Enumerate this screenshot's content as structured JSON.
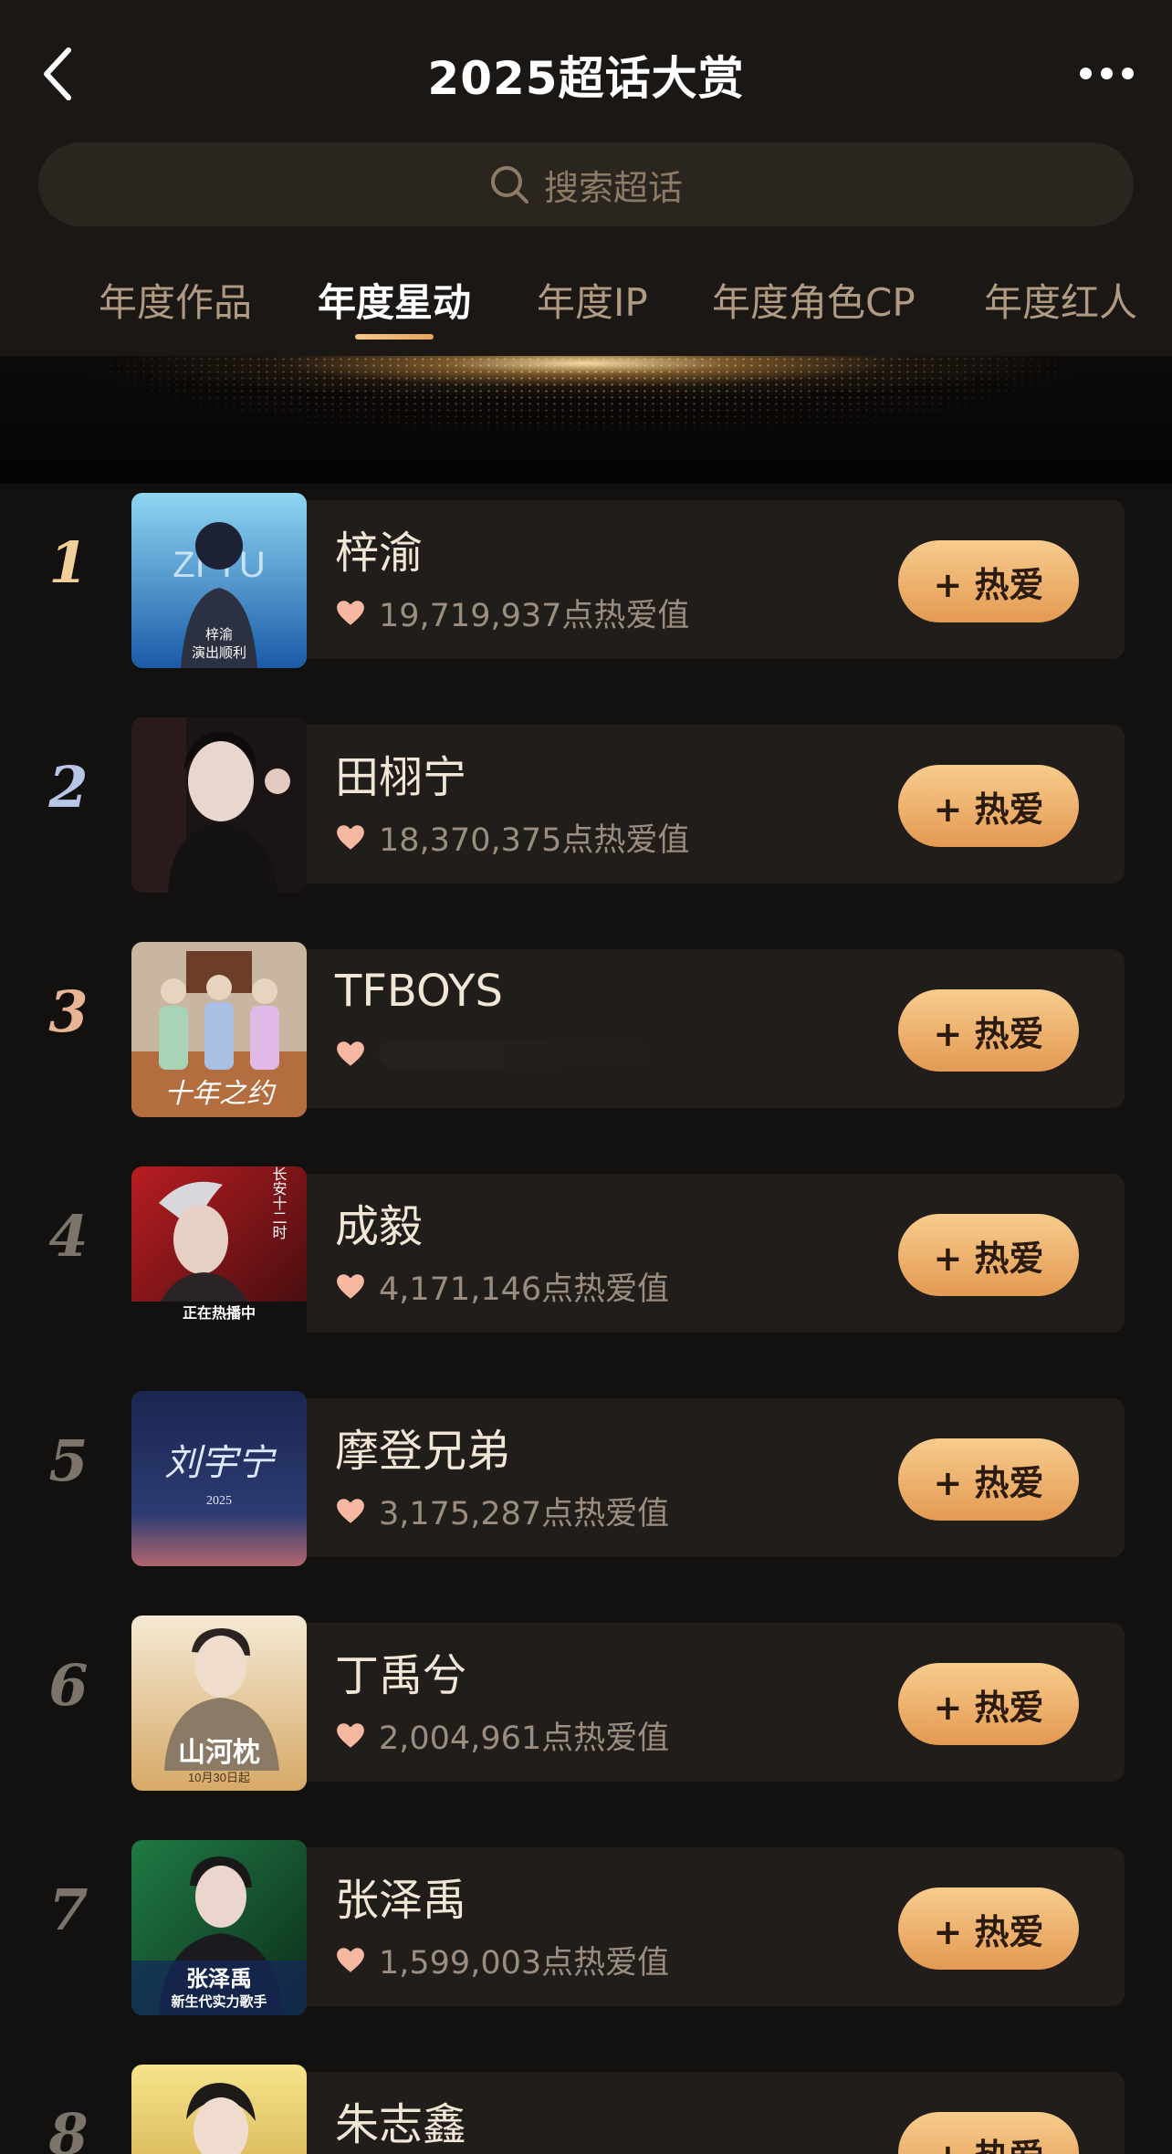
{
  "header": {
    "title": "2025超话大赏"
  },
  "search": {
    "placeholder": "搜索超话"
  },
  "tabs": [
    {
      "label": "年度作品",
      "active": false
    },
    {
      "label": "年度星动",
      "active": true
    },
    {
      "label": "年度IP",
      "active": false
    },
    {
      "label": "年度角色CP",
      "active": false
    },
    {
      "label": "年度红人",
      "active": false
    }
  ],
  "colors": {
    "accent": "#f0b873",
    "button_top": "#f7cc8d",
    "button_bottom": "#e49a52",
    "background": "#121110",
    "card": "#211d1a"
  },
  "list": [
    {
      "rank": "1",
      "name": "梓渝",
      "heat": "19,719,937点热爱值",
      "button": "+ 热爱"
    },
    {
      "rank": "2",
      "name": "田栩宁",
      "heat": "18,370,375点热爱值",
      "button": "+ 热爱"
    },
    {
      "rank": "3",
      "name": "TFBOYS",
      "heat": "",
      "button": "+ 热爱"
    },
    {
      "rank": "4",
      "name": "成毅",
      "heat": "4,171,146点热爱值",
      "button": "+ 热爱"
    },
    {
      "rank": "5",
      "name": "摩登兄弟",
      "heat": "3,175,287点热爱值",
      "button": "+ 热爱"
    },
    {
      "rank": "6",
      "name": "丁禹兮",
      "heat": "2,004,961点热爱值",
      "button": "+ 热爱"
    },
    {
      "rank": "7",
      "name": "张泽禹",
      "heat": "1,599,003点热爱值",
      "button": "+ 热爱"
    },
    {
      "rank": "8",
      "name": "朱志鑫",
      "heat": "",
      "button": "+ 热爱"
    }
  ],
  "thumbnails": {
    "t1": {
      "text": "ZI YU",
      "sub1": "梓渝",
      "sub2": "演出顺利"
    },
    "t3": {
      "text": "十年之约"
    },
    "t4": {
      "text1": "长安十二时",
      "text2": "正在热播中"
    },
    "t5": {
      "text": "刘宇宁",
      "sub": "2025"
    },
    "t6": {
      "text": "山河枕",
      "sub": "10月30日起"
    },
    "t7": {
      "text1": "张泽禹",
      "text2": "新生代实力歌手"
    }
  }
}
